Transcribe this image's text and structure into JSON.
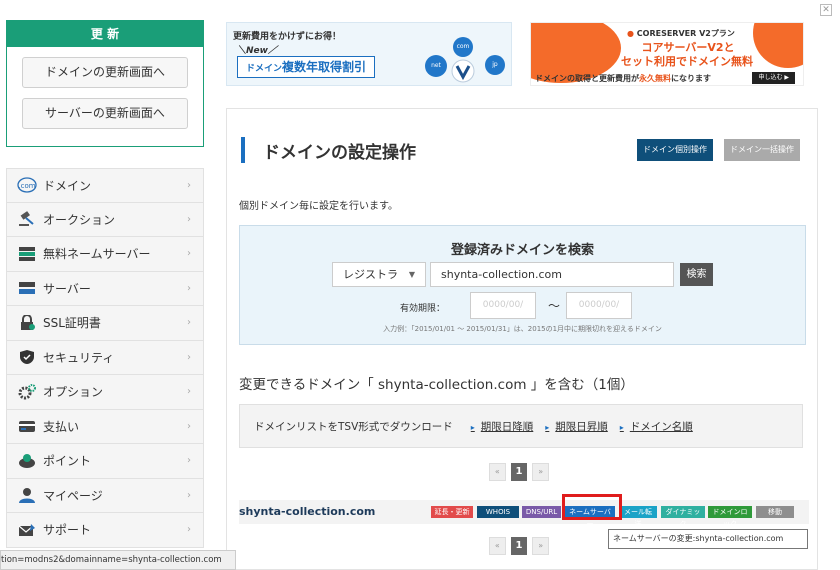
{
  "renew": {
    "header": "更 新",
    "domain_btn": "ドメインの更新画面へ",
    "server_btn": "サーバーの更新画面へ"
  },
  "sidebar": {
    "items": [
      {
        "label": "ドメイン",
        "icon": "dotcom-icon"
      },
      {
        "label": "オークション",
        "icon": "gavel-icon"
      },
      {
        "label": "無料ネームサーバー",
        "icon": "server-stack-icon"
      },
      {
        "label": "サーバー",
        "icon": "server-icon"
      },
      {
        "label": "SSL証明書",
        "icon": "ssl-lock-icon"
      },
      {
        "label": "セキュリティ",
        "icon": "shield-icon"
      },
      {
        "label": "オプション",
        "icon": "gear-icon"
      },
      {
        "label": "支払い",
        "icon": "card-icon"
      },
      {
        "label": "ポイント",
        "icon": "points-icon"
      },
      {
        "label": "マイページ",
        "icon": "person-icon"
      },
      {
        "label": "サポート",
        "icon": "mail-icon"
      }
    ]
  },
  "banner1": {
    "line1": "更新費用をかけずにお得！",
    "line2": "＼New／",
    "line3_small": "ドメイン",
    "line3_big": "複数年取得割引",
    "bubbles": [
      "net",
      "com",
      "jp"
    ]
  },
  "banner2": {
    "brand": "CORESERVER V2プラン",
    "line1": "コアサーバーV2と",
    "line2": "セット利用でドメイン無料",
    "line3a": "ドメインの取得と更新費用が",
    "line3b": "永久無料",
    "line3c": "になります",
    "btn": "申し込む ▶"
  },
  "main": {
    "title": "ドメインの設定操作",
    "tab_individual": "ドメイン個別操作",
    "tab_bulk": "ドメイン一括操作",
    "description": "個別ドメイン毎に設定を行います。"
  },
  "search": {
    "title": "登録済みドメインを検索",
    "select_value": "レジストラ",
    "input_value": "shynta-collection.com",
    "button": "検索",
    "expiry_label": "有効期限：",
    "date_placeholder_from": "0000/00/",
    "date_placeholder_to": "0000/00/",
    "tilde": "～",
    "example": "入力例：「2015/01/01 ～ 2015/01/31」は、2015の1月中に期限切れを迎えるドメイン"
  },
  "results": {
    "title": "変更できるドメイン「 shynta-collection.com 」を含む（1個）",
    "download_label": "ドメインリストをTSV形式でダウンロード",
    "sort_desc": "期限日降順",
    "sort_asc": "期限日昇順",
    "sort_name": "ドメイン名順"
  },
  "pager": {
    "prev": "«",
    "current": "1",
    "next": "»"
  },
  "domain_row": {
    "name": "shynta-collection.com",
    "tags": [
      {
        "label": "延長・更新",
        "color": "#e24b4b"
      },
      {
        "label": "WHOIS",
        "color": "#0f4f7a"
      },
      {
        "label": "DNS/URL",
        "color": "#7a5aa8"
      },
      {
        "label": "ネームサーバー",
        "color": "#1b6fc0"
      },
      {
        "label": "メール転送",
        "color": "#1ba3c7"
      },
      {
        "label": "ダイナミック",
        "color": "#2fb0a0"
      },
      {
        "label": "ドメインロック",
        "color": "#2f9a3a"
      },
      {
        "label": "移動",
        "color": "#8e8e8e"
      }
    ]
  },
  "tooltip": "ネームサーバーの変更:shynta-collection.com",
  "status_url": "tion=modns2&domainname=shynta-collection.com"
}
